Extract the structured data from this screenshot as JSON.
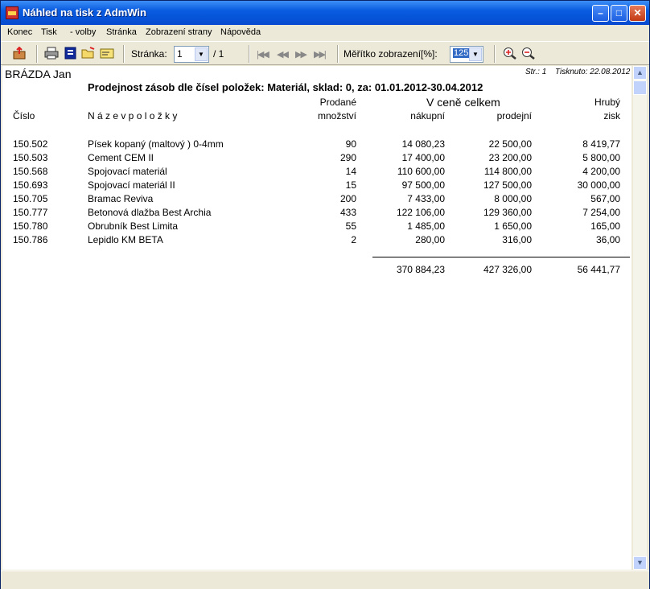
{
  "window": {
    "title": "Náhled na tisk z AdmWin"
  },
  "menu": [
    "Konec",
    "Tisk",
    "- volby",
    "Stránka",
    "Zobrazení strany",
    "Nápověda"
  ],
  "toolbar": {
    "page_label": "Stránka:",
    "page_value": "1",
    "page_total": "/ 1",
    "zoom_label": "Měřítko zobrazení[%]:",
    "zoom_value": "125"
  },
  "report": {
    "owner": "BRÁZDA Jan",
    "page_info": "Str.: 1",
    "printed": "Tisknuto: 22.08.2012",
    "title": "Prodejnost zásob dle čísel položek: Materiál, sklad:  0, za: 01.01.2012-30.04.2012",
    "headers": {
      "col_number": "Číslo",
      "col_name": "N á z e v   p o l o ž k y",
      "sold_1": "Prodané",
      "sold_2": "množství",
      "price_group": "V ceně celkem",
      "purchase": "nákupní",
      "sale": "prodejní",
      "profit_1": "Hrubý",
      "profit_2": "zisk"
    },
    "rows": [
      {
        "no": "150.502",
        "name": "Písek kopaný (maltový ) 0-4mm",
        "qty": "90",
        "purchase": "14 080,23",
        "sale": "22 500,00",
        "profit": "8 419,77"
      },
      {
        "no": "150.503",
        "name": "Cement CEM II",
        "qty": "290",
        "purchase": "17 400,00",
        "sale": "23 200,00",
        "profit": "5 800,00"
      },
      {
        "no": "150.568",
        "name": "Spojovací materiál",
        "qty": "14",
        "purchase": "110 600,00",
        "sale": "114 800,00",
        "profit": "4 200,00"
      },
      {
        "no": "150.693",
        "name": "Spojovací materiál II",
        "qty": "15",
        "purchase": "97 500,00",
        "sale": "127 500,00",
        "profit": "30 000,00"
      },
      {
        "no": "150.705",
        "name": "Bramac Reviva",
        "qty": "200",
        "purchase": "7 433,00",
        "sale": "8 000,00",
        "profit": "567,00"
      },
      {
        "no": "150.777",
        "name": "Betonová dlažba Best Archia",
        "qty": "433",
        "purchase": "122 106,00",
        "sale": "129 360,00",
        "profit": "7 254,00"
      },
      {
        "no": "150.780",
        "name": "Obrubník Best Limita",
        "qty": "55",
        "purchase": "1 485,00",
        "sale": "1 650,00",
        "profit": "165,00"
      },
      {
        "no": "150.786",
        "name": "Lepidlo KM BETA",
        "qty": "2",
        "purchase": "280,00",
        "sale": "316,00",
        "profit": "36,00"
      }
    ],
    "totals": {
      "purchase": "370 884,23",
      "sale": "427 326,00",
      "profit": "56 441,77"
    }
  }
}
